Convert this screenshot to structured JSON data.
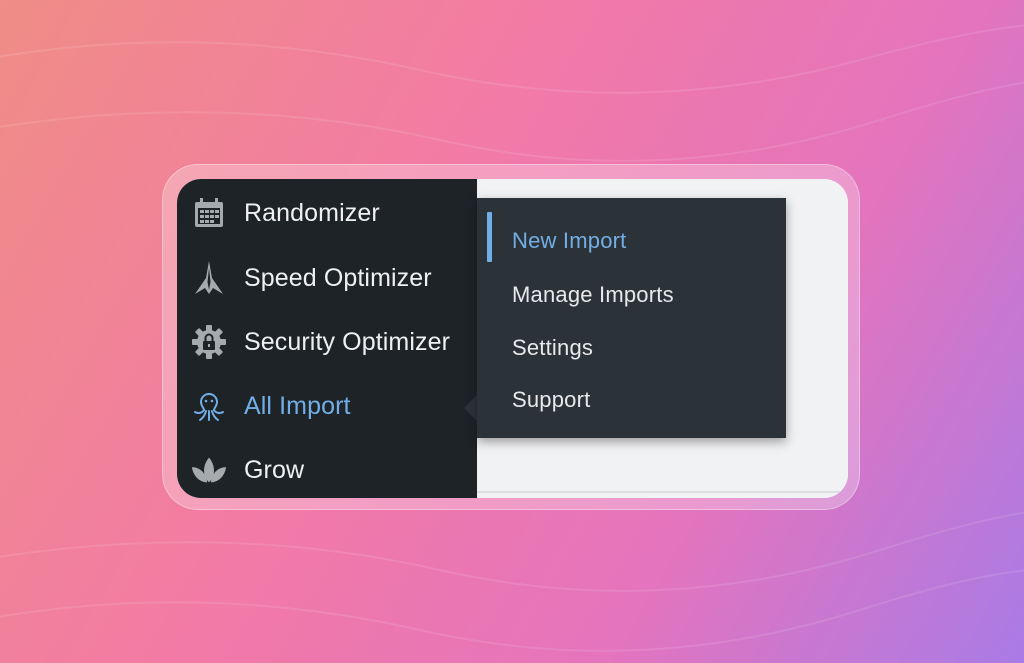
{
  "sidebar": {
    "items": [
      {
        "label": "Randomizer",
        "icon": "calendar-icon"
      },
      {
        "label": "Speed Optimizer",
        "icon": "rocket-icon"
      },
      {
        "label": "Security Optimizer",
        "icon": "gear-lock-icon"
      },
      {
        "label": "All Import",
        "icon": "octopus-icon",
        "active": true
      },
      {
        "label": "Grow",
        "icon": "leaves-icon"
      }
    ]
  },
  "submenu": {
    "items": [
      {
        "label": "New Import",
        "current": true
      },
      {
        "label": "Manage Imports"
      },
      {
        "label": "Settings"
      },
      {
        "label": "Support"
      }
    ]
  },
  "colors": {
    "sidebar_bg": "#1e2327",
    "submenu_bg": "#2c3338",
    "accent": "#72aee6",
    "content_bg": "#f1f2f4",
    "menu_text": "#f0f0f1"
  }
}
